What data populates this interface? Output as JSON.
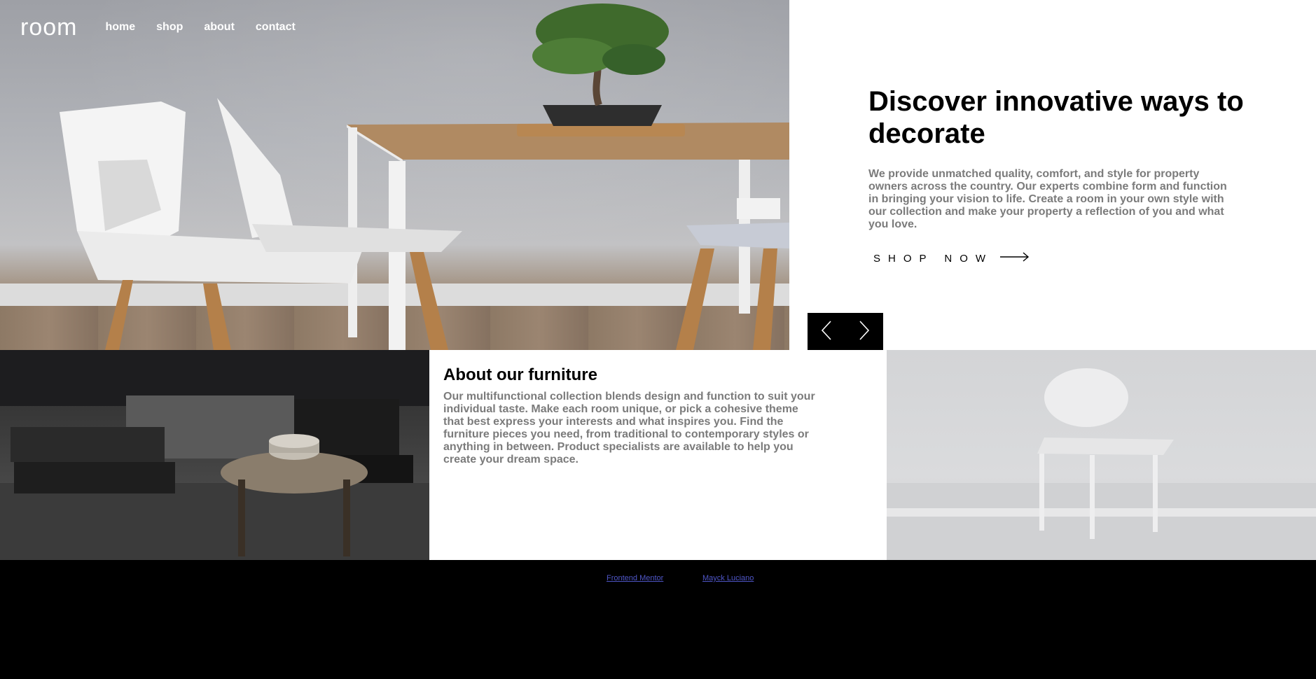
{
  "nav": {
    "logo": "room",
    "links": [
      "home",
      "shop",
      "about",
      "contact"
    ]
  },
  "hero": {
    "title": "Discover innovative ways to decorate",
    "description": "We provide unmatched quality, comfort, and style for property owners across the country. Our experts combine form and function in bringing your vision to life. Create a room in your own style with our collection and make your property a reflection of you and what you love.",
    "cta_label": "SHOP NOW",
    "cta_icon": "arrow-right-icon"
  },
  "slider": {
    "prev_icon": "chevron-left-icon",
    "next_icon": "chevron-right-icon"
  },
  "about": {
    "title": "About our furniture",
    "description": "Our multifunctional collection blends design and function to suit your individual taste. Make each room unique, or pick a cohesive theme that best express your interests and what inspires you. Find the furniture pieces you need, from traditional to contemporary styles or anything in between. Product specialists are available to help you create your dream space."
  },
  "footer": {
    "links": [
      "Frontend Mentor",
      "Mayck Luciano"
    ]
  },
  "colors": {
    "text_primary": "#000000",
    "text_muted": "#7b7b7b",
    "footer_bg": "#000000",
    "link": "#4f56c7"
  }
}
